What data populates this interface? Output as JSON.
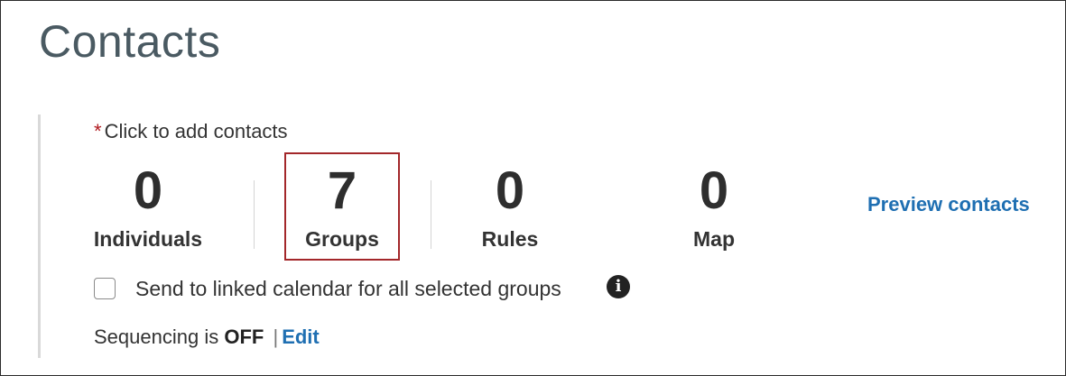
{
  "page": {
    "title": "Contacts"
  },
  "contacts": {
    "required_marker": "*",
    "add_prompt": "Click to add contacts",
    "stats": [
      {
        "value": "0",
        "label": "Individuals"
      },
      {
        "value": "7",
        "label": "Groups"
      },
      {
        "value": "0",
        "label": "Rules"
      },
      {
        "value": "0",
        "label": "Map"
      }
    ],
    "preview_link": "Preview contacts",
    "calendar_checkbox": {
      "label": "Send to linked calendar for all selected groups",
      "checked": false
    },
    "info_icon": "info-circle-icon",
    "sequencing": {
      "prefix": "Sequencing is",
      "status": "OFF",
      "separator": "|",
      "edit_label": "Edit"
    }
  },
  "colors": {
    "accent_link": "#1f6fb2",
    "highlight_border": "#a3272a",
    "required": "#b0191e",
    "title": "#4a5a62"
  }
}
